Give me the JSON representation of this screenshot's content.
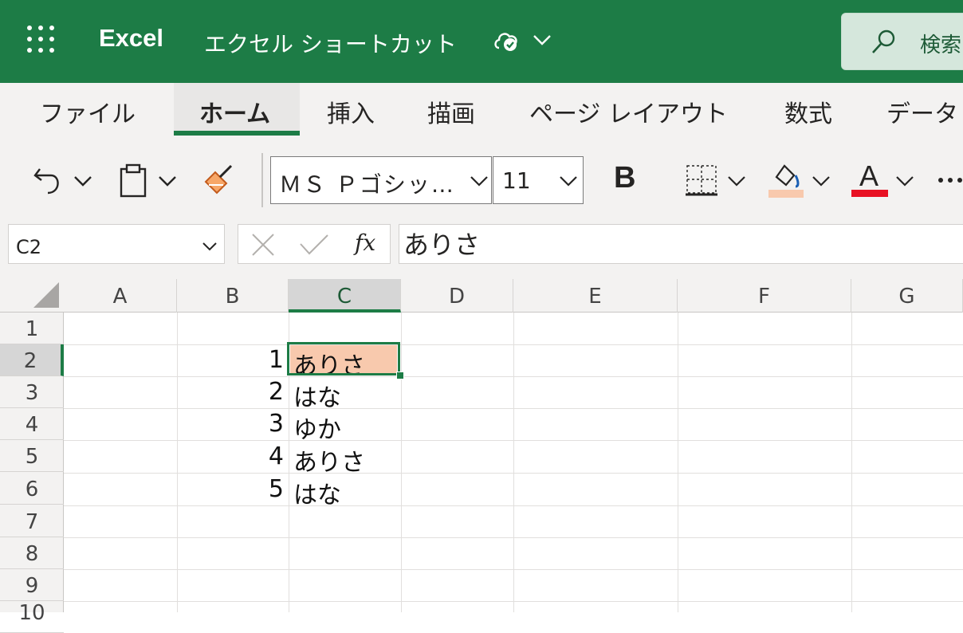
{
  "titlebar": {
    "app_name": "Excel",
    "doc_title": "エクセル ショートカット",
    "search_placeholder": "検索"
  },
  "ribbon": {
    "tabs": [
      "ファイル",
      "ホーム",
      "挿入",
      "描画",
      "ページ レイアウト",
      "数式",
      "データ"
    ],
    "active_tab": "ホーム"
  },
  "toolbar": {
    "font_name": "ＭＳ Ｐゴシッ…",
    "font_size": "11",
    "bold_label": "B",
    "font_color_label": "A",
    "fill_color": "#f8c9ad",
    "font_color": "#e81123"
  },
  "formula_bar": {
    "name_box": "C2",
    "fx_label": "fx",
    "formula": "ありさ"
  },
  "grid": {
    "columns": [
      "A",
      "B",
      "C",
      "D",
      "E",
      "F",
      "G"
    ],
    "selected_column": "C",
    "rows": [
      "1",
      "2",
      "3",
      "4",
      "5",
      "6",
      "7",
      "8",
      "9",
      "10"
    ],
    "selected_row": "2",
    "active_cell": "C2",
    "cells": [
      {
        "ref": "B2",
        "value": "1"
      },
      {
        "ref": "C2",
        "value": "ありさ"
      },
      {
        "ref": "B3",
        "value": "2"
      },
      {
        "ref": "C3",
        "value": "はな"
      },
      {
        "ref": "B4",
        "value": "3"
      },
      {
        "ref": "C4",
        "value": "ゆか"
      },
      {
        "ref": "B5",
        "value": "4"
      },
      {
        "ref": "C5",
        "value": "ありさ"
      },
      {
        "ref": "B6",
        "value": "5"
      },
      {
        "ref": "C6",
        "value": "はな"
      }
    ]
  },
  "colors": {
    "brand_green": "#1d7c46",
    "chrome_gray": "#f3f2f1"
  }
}
